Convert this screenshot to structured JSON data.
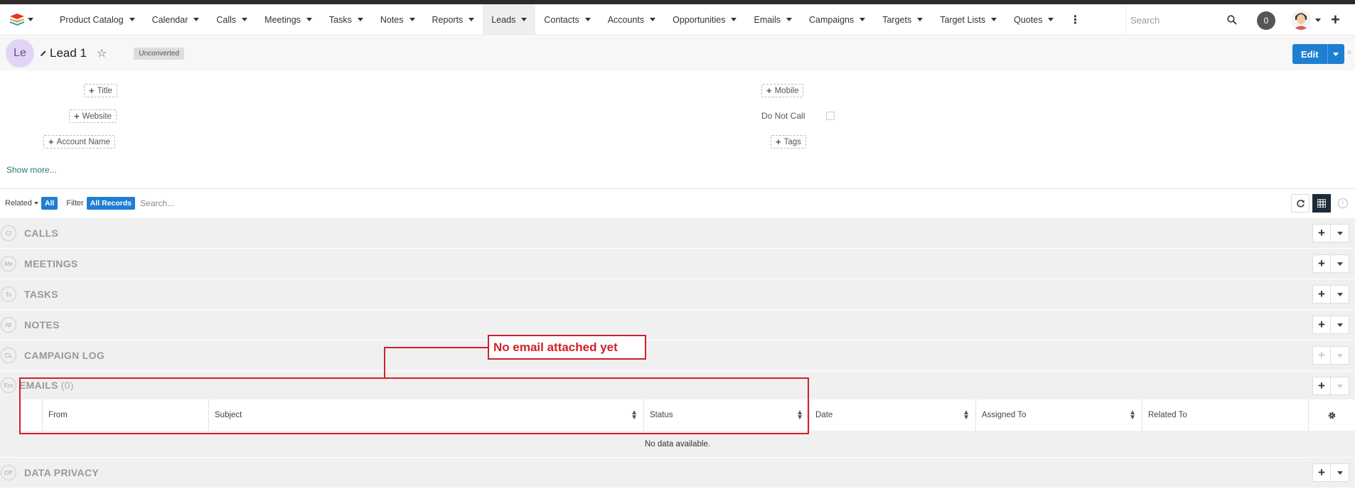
{
  "nav": {
    "items": [
      {
        "label": "Product Catalog",
        "caret": true
      },
      {
        "label": "Calendar",
        "caret": true
      },
      {
        "label": "Calls",
        "caret": true
      },
      {
        "label": "Meetings",
        "caret": true
      },
      {
        "label": "Tasks",
        "caret": true
      },
      {
        "label": "Notes",
        "caret": true
      },
      {
        "label": "Reports",
        "caret": true
      },
      {
        "label": "Leads",
        "caret": true,
        "active": true
      },
      {
        "label": "Contacts",
        "caret": true
      },
      {
        "label": "Accounts",
        "caret": true
      },
      {
        "label": "Opportunities",
        "caret": true
      },
      {
        "label": "Emails",
        "caret": true
      },
      {
        "label": "Campaigns",
        "caret": true
      },
      {
        "label": "Targets",
        "caret": true
      },
      {
        "label": "Target Lists",
        "caret": true
      },
      {
        "label": "Quotes",
        "caret": true
      }
    ],
    "search_placeholder": "Search",
    "notification_count": "0"
  },
  "header": {
    "avatar_initials": "Le",
    "record_name": "Lead 1",
    "status": "Unconverted",
    "edit_label": "Edit"
  },
  "fields": {
    "title": "Title",
    "website": "Website",
    "account_name": "Account Name",
    "mobile": "Mobile",
    "do_not_call": "Do Not Call",
    "tags": "Tags",
    "show_more": "Show more..."
  },
  "related_bar": {
    "related_label": "Related",
    "related_value": "All",
    "filter_label": "Filter",
    "filter_value": "All Records",
    "search_placeholder": "Search..."
  },
  "panels": [
    {
      "abbr": "Cl",
      "title": "CALLS",
      "disabled": false
    },
    {
      "abbr": "Me",
      "title": "MEETINGS",
      "disabled": false
    },
    {
      "abbr": "Ts",
      "title": "TASKS",
      "disabled": false
    },
    {
      "abbr": "Nt",
      "title": "NOTES",
      "disabled": false
    },
    {
      "abbr": "CL",
      "title": "CAMPAIGN LOG",
      "disabled": true
    }
  ],
  "emails": {
    "abbr": "Em",
    "title": "EMAILS",
    "count": "(0)",
    "columns": [
      "From",
      "Subject",
      "Status",
      "Date",
      "Assigned To",
      "Related To"
    ],
    "no_data": "No data available."
  },
  "data_privacy": {
    "abbr": "DP",
    "title": "DATA PRIVACY"
  },
  "annotation": {
    "text": "No email attached yet",
    "color": "#d12027"
  }
}
